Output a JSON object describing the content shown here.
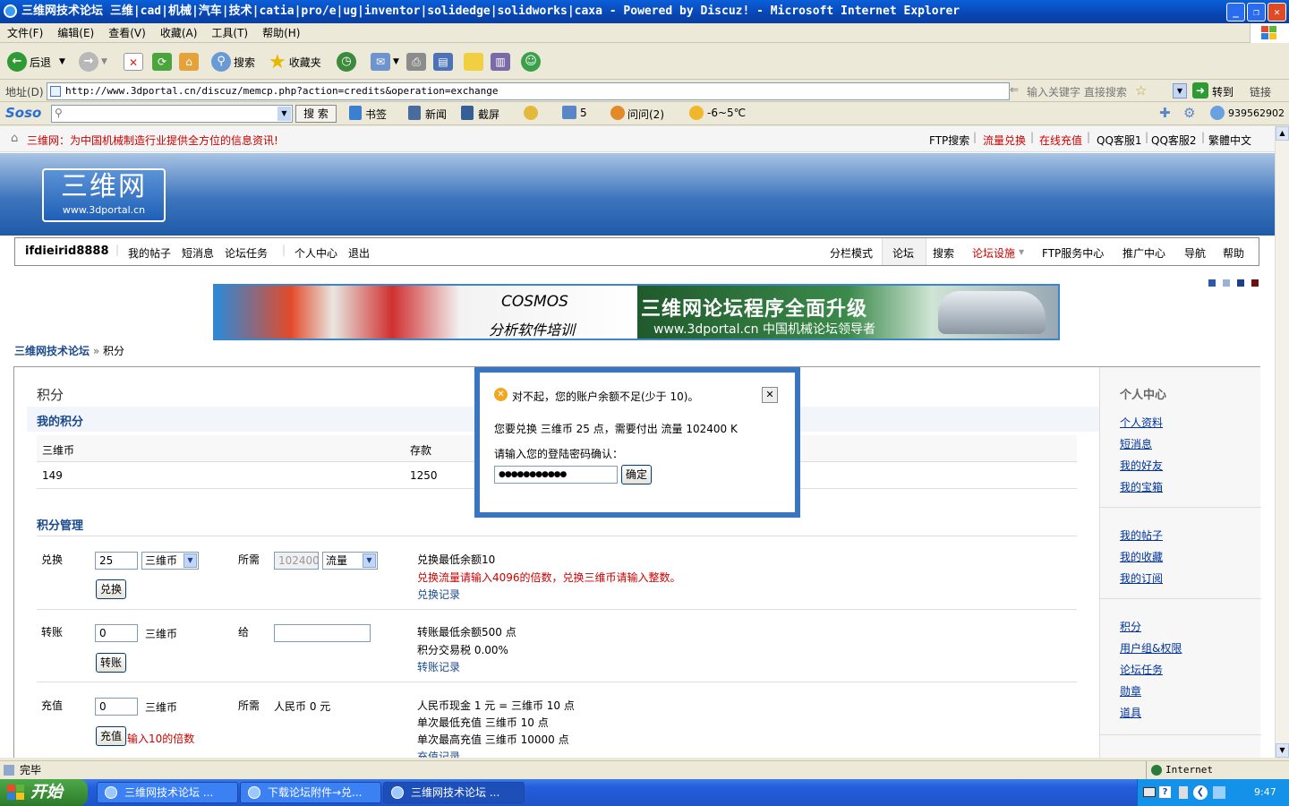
{
  "window": {
    "title": "三维网技术论坛 三维|cad|机械|汽车|技术|catia|pro/e|ug|inventor|solidedge|solidworks|caxa - Powered by Discuz! - Microsoft Internet Explorer",
    "min": "_",
    "max": "❐",
    "close": "✕"
  },
  "menu": [
    "文件(F)",
    "编辑(E)",
    "查看(V)",
    "收藏(A)",
    "工具(T)",
    "帮助(H)"
  ],
  "toolbar": {
    "back": "后退",
    "search": "搜索",
    "favorites": "收藏夹"
  },
  "address": {
    "label": "地址(D)",
    "url": "http://www.3dportal.cn/discuz/memcp.php?action=credits&operation=exchange",
    "search_hint": "输入关键字 直接搜索",
    "go": "转到",
    "links": "链接"
  },
  "soso": {
    "logo": "Soso",
    "search_btn": "搜 索",
    "bookmarks": "书签",
    "news": "新闻",
    "screenshot": "截屏",
    "mail_count": "5",
    "ask": "问问(2)",
    "weather": "-6~5℃",
    "qq": "939562902"
  },
  "page": {
    "slogan": "三维网：为中国机械制造行业提供全方位的信息资讯!",
    "toplinks": [
      "FTP搜索",
      "流量兑换",
      "在线充值",
      "QQ客服1",
      "QQ客服2",
      "繁體中文"
    ],
    "logo_main": "三维网",
    "logo_sub": "www.3dportal.cn",
    "username": "ifdieirid8888",
    "navleft": [
      "我的帖子",
      "短消息",
      "论坛任务",
      "个人中心",
      "退出"
    ],
    "navright": [
      "分栏模式",
      "论坛",
      "搜索",
      "论坛设施",
      "FTP服务中心",
      "推广中心",
      "导航",
      "帮助"
    ],
    "ad": {
      "left_title": "COSMOS",
      "left_sub": "分析软件培训",
      "right_title": "三维网论坛程序全面升级",
      "right_sub": "www.3dportal.cn 中国机械论坛领导者"
    },
    "breadcrumb": {
      "home": "三维网技术论坛",
      "sep": "»",
      "current": "积分"
    },
    "section_title": "积分",
    "my_credits": "我的积分",
    "credits_table": {
      "headers": [
        "三维币",
        "存款"
      ],
      "values": [
        "149",
        "1250"
      ]
    },
    "manage_title": "积分管理",
    "exchange": {
      "label": "兑换",
      "amount": "25",
      "currency": "三维币",
      "need_label": "所需",
      "need_value": "102400",
      "need_unit": "流量",
      "button": "兑换",
      "info1": "兑换最低余额10",
      "info2": "兑换流量请输入4096的倍数，兑换三维币请输入整数。",
      "record": "兑换记录"
    },
    "transfer": {
      "label": "转账",
      "amount": "0",
      "currency": "三维币",
      "to_label": "给",
      "button": "转账",
      "info1": "转账最低余额500 点",
      "info2": "积分交易税 0.00%",
      "record": "转账记录"
    },
    "recharge": {
      "label": "充值",
      "amount": "0",
      "currency": "三维币",
      "need_label": "所需",
      "need_value": "人民币 0 元",
      "button": "充值",
      "tip": "输入10的倍数",
      "info1": "人民币现金 1 元 = 三维币 10 点",
      "info2": "单次最低充值 三维币 10 点",
      "info3": "单次最高充值 三维币 10000 点",
      "record": "充值记录"
    },
    "sidebar": {
      "title": "个人中心",
      "group1": [
        "个人资料",
        "短消息",
        "我的好友",
        "我的宝箱"
      ],
      "group2": [
        "我的帖子",
        "我的收藏",
        "我的订阅"
      ],
      "group3": [
        "积分",
        "用户组&权限",
        "论坛任务",
        "勋章",
        "道具"
      ]
    }
  },
  "modal": {
    "message": "对不起，您的账户余额不足(少于 10)。",
    "detail": "您要兑换 三维币 25 点，需要付出 流量 102400 K",
    "prompt": "请输入您的登陆密码确认：",
    "password": "●●●●●●●●●●●",
    "ok": "确定",
    "close": "✕"
  },
  "status": {
    "text": "完毕",
    "zone": "Internet"
  },
  "taskbar": {
    "start": "开始",
    "tasks": [
      "三维网技术论坛 ...",
      "下载论坛附件→兑...",
      "三维网技术论坛 ..."
    ],
    "clock": "9:47"
  }
}
